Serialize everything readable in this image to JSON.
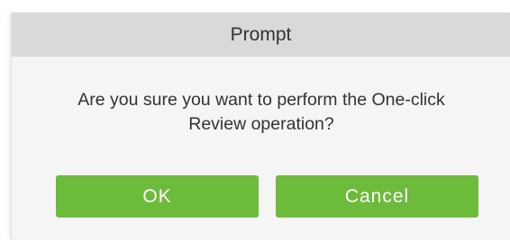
{
  "dialog": {
    "title": "Prompt",
    "message_line1": "Are you sure you want to perform the One-click",
    "message_line2": "Review operation?",
    "ok_label": "OK",
    "cancel_label": "Cancel"
  },
  "colors": {
    "title_bar": "#d9d9d9",
    "dialog_body": "#f5f5f5",
    "button": "#6dbb3a",
    "button_text": "#ffffff",
    "text": "#333333"
  }
}
